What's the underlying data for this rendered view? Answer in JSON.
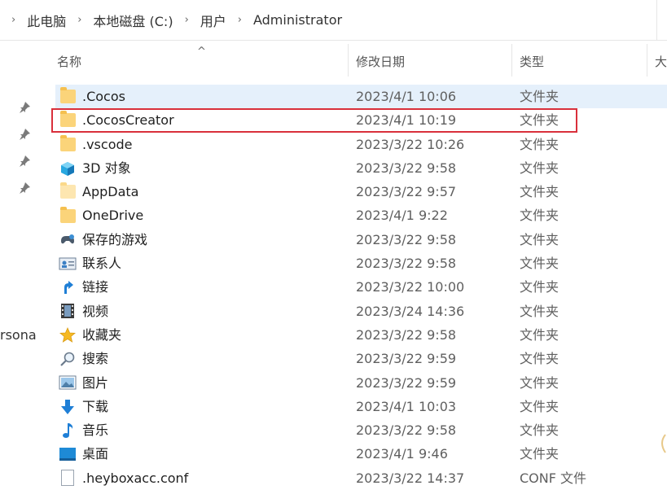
{
  "breadcrumb": {
    "items": [
      "此电脑",
      "本地磁盘 (C:)",
      "用户",
      "Administrator"
    ],
    "leading_chevron": "›",
    "separator": "›"
  },
  "nav_partial_label": "rsona",
  "columns": {
    "name": "名称",
    "date": "修改日期",
    "type": "类型",
    "size_partial": "大"
  },
  "sort_indicator": "^",
  "rows": [
    {
      "name": ".Cocos",
      "date": "2023/4/1 10:06",
      "type": "文件夹",
      "icon": "folder-icon"
    },
    {
      "name": ".CocosCreator",
      "date": "2023/4/1 10:19",
      "type": "文件夹",
      "icon": "folder-icon"
    },
    {
      "name": ".vscode",
      "date": "2023/3/22 10:26",
      "type": "文件夹",
      "icon": "folder-icon"
    },
    {
      "name": "3D 对象",
      "date": "2023/3/22 9:58",
      "type": "文件夹",
      "icon": "3d-objects-icon"
    },
    {
      "name": "AppData",
      "date": "2023/3/22 9:57",
      "type": "文件夹",
      "icon": "folder-icon"
    },
    {
      "name": "OneDrive",
      "date": "2023/4/1 9:22",
      "type": "文件夹",
      "icon": "folder-icon"
    },
    {
      "name": "保存的游戏",
      "date": "2023/3/22 9:58",
      "type": "文件夹",
      "icon": "saved-games-icon"
    },
    {
      "name": "联系人",
      "date": "2023/3/22 9:58",
      "type": "文件夹",
      "icon": "contacts-icon"
    },
    {
      "name": "链接",
      "date": "2023/3/22 10:00",
      "type": "文件夹",
      "icon": "links-icon"
    },
    {
      "name": "视频",
      "date": "2023/3/24 14:36",
      "type": "文件夹",
      "icon": "videos-icon"
    },
    {
      "name": "收藏夹",
      "date": "2023/3/22 9:58",
      "type": "文件夹",
      "icon": "favorites-icon"
    },
    {
      "name": "搜索",
      "date": "2023/3/22 9:59",
      "type": "文件夹",
      "icon": "searches-icon"
    },
    {
      "name": "图片",
      "date": "2023/3/22 9:59",
      "type": "文件夹",
      "icon": "pictures-icon"
    },
    {
      "name": "下载",
      "date": "2023/4/1 10:03",
      "type": "文件夹",
      "icon": "downloads-icon"
    },
    {
      "name": "音乐",
      "date": "2023/3/22 9:58",
      "type": "文件夹",
      "icon": "music-icon"
    },
    {
      "name": "桌面",
      "date": "2023/4/1 9:46",
      "type": "文件夹",
      "icon": "desktop-icon"
    },
    {
      "name": ".heyboxacc.conf",
      "date": "2023/3/22 14:37",
      "type": "CONF 文件",
      "icon": "file-icon"
    }
  ],
  "colors": {
    "selection": "#e5f0fb",
    "highlight_box": "#d9303b",
    "folder": "#fbd47a"
  }
}
